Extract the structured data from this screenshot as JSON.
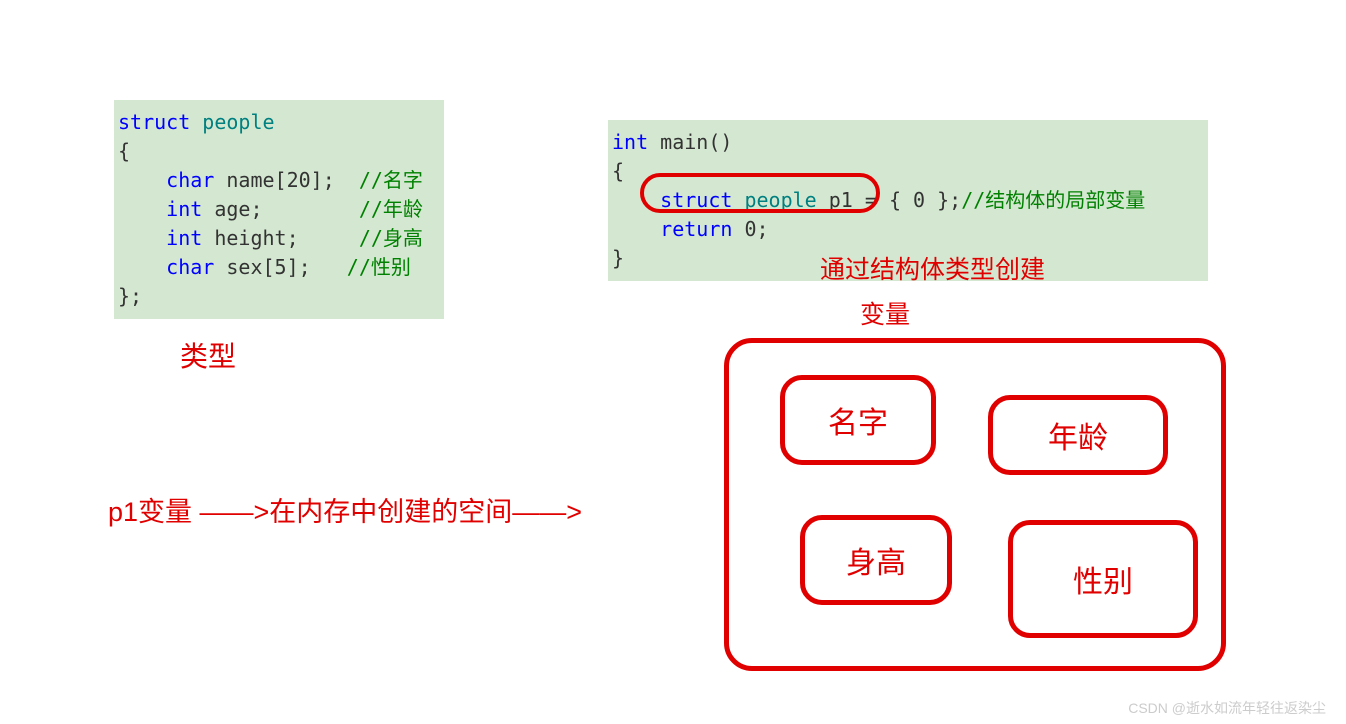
{
  "code_left": {
    "l1_kw": "struct",
    "l1_type": "people",
    "l2": "{",
    "l3_kw": "    char",
    "l3_rest": " name[20];",
    "l3_comment": "//名字",
    "l4_kw": "    int",
    "l4_rest": " age;      ",
    "l4_comment": "//年龄",
    "l5_kw": "    int",
    "l5_rest": " height;   ",
    "l5_comment": "//身高",
    "l6_kw": "    char",
    "l6_rest": " sex[5]; ",
    "l6_comment": "//性别",
    "l7": "};"
  },
  "code_right": {
    "l1_kw": "int",
    "l1_rest": " main()",
    "l2": "{",
    "l3_kw": "    struct",
    "l3_type": " people",
    "l3_rest": " p1 = { 0 };",
    "l3_comment": "//结构体的局部变量",
    "l4_kw": "    return",
    "l4_rest": " 0;",
    "l5": "}"
  },
  "labels": {
    "type": "类型",
    "create": "通过结构体类型创建",
    "var": "变量",
    "p1": "p1变量 ——>在内存中创建的空间——>"
  },
  "fields": {
    "name": "名字",
    "age": "年龄",
    "height": "身高",
    "sex": "性别"
  },
  "watermark": "CSDN @逝水如流年轻往返染尘"
}
